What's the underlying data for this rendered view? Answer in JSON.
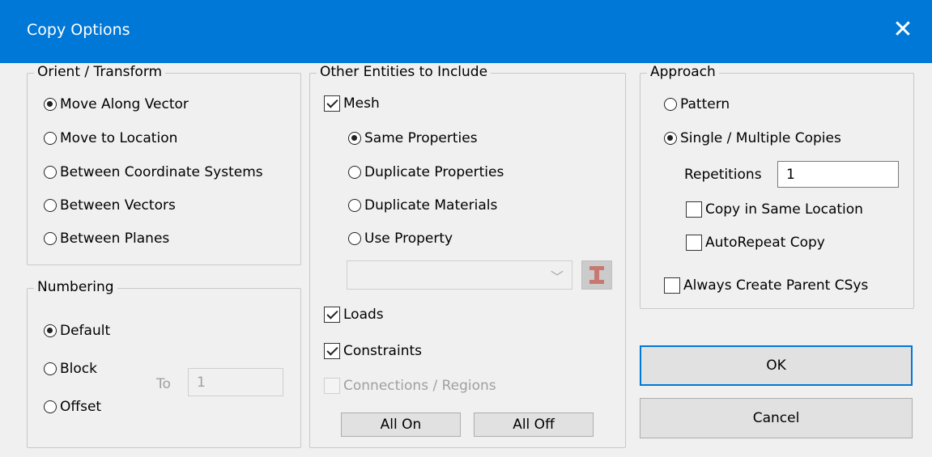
{
  "window": {
    "title": "Copy Options",
    "close_glyph": "✕"
  },
  "orient": {
    "legend": "Orient / Transform",
    "options": [
      "Move Along Vector",
      "Move to Location",
      "Between Coordinate Systems",
      "Between Vectors",
      "Between Planes"
    ],
    "selected": "Move Along Vector"
  },
  "numbering": {
    "legend": "Numbering",
    "options": [
      "Default",
      "Block",
      "Offset"
    ],
    "selected": "Default",
    "to_label": "To",
    "to_value": "1"
  },
  "entities": {
    "legend": "Other Entities to Include",
    "mesh_label": "Mesh",
    "mesh_checked": true,
    "mesh_options": [
      "Same Properties",
      "Duplicate Properties",
      "Duplicate Materials",
      "Use Property"
    ],
    "mesh_selected": "Same Properties",
    "property_value": "",
    "property_button_icon": "i-beam-icon",
    "loads_label": "Loads",
    "loads_checked": true,
    "constraints_label": "Constraints",
    "constraints_checked": true,
    "connections_label": "Connections / Regions",
    "connections_checked": false,
    "all_on_label": "All On",
    "all_off_label": "All Off"
  },
  "approach": {
    "legend": "Approach",
    "options": [
      "Pattern",
      "Single / Multiple Copies"
    ],
    "selected": "Single / Multiple Copies",
    "repetitions_label": "Repetitions",
    "repetitions_value": "1",
    "copy_same_location_label": "Copy in Same Location",
    "copy_same_location_checked": false,
    "autorepeat_label": "AutoRepeat Copy",
    "autorepeat_checked": false,
    "always_parent_csys_label": "Always Create Parent CSys",
    "always_parent_csys_checked": false
  },
  "buttons": {
    "ok_label": "OK",
    "cancel_label": "Cancel"
  },
  "colors": {
    "titlebar": "#0078d7",
    "background": "#f0f0f0",
    "i_beam": "#c87870"
  }
}
